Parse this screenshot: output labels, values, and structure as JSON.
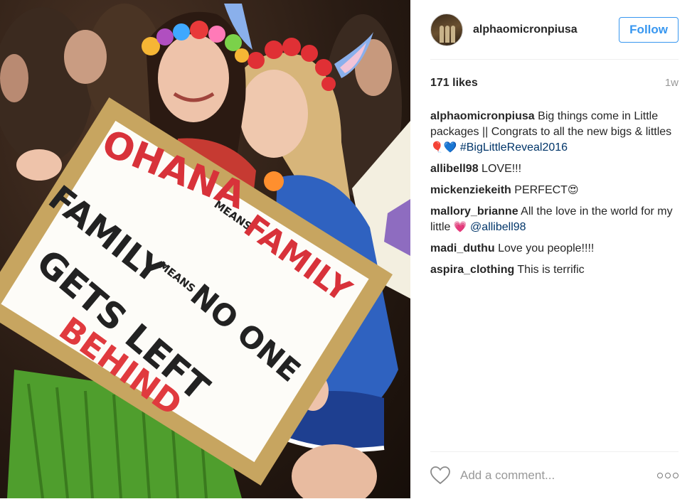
{
  "post": {
    "username": "alphaomicronpiusa",
    "follow_label": "Follow",
    "likes": "171 likes",
    "age": "1w",
    "caption": {
      "user": "alphaomicronpiusa",
      "text": "Big things come in Little packages || Congrats to all the new bigs & littles",
      "emoji": "🎈💙",
      "hashtag": "#BigLittleReveal2016"
    },
    "comments": [
      {
        "user": "allibell98",
        "text": "LOVE!!!",
        "emoji": ""
      },
      {
        "user": "mickenziekeith",
        "text": "PERFECT",
        "emoji": "😍"
      },
      {
        "user": "mallory_brianne",
        "text": "All the love in the world for my little",
        "emoji": "💗",
        "mention": "@allibell98"
      },
      {
        "user": "madi_duthu",
        "text": "Love you people!!!!",
        "emoji": ""
      },
      {
        "user": "aspira_clothing",
        "text": "This is terrific",
        "emoji": ""
      }
    ],
    "add_comment_placeholder": "Add a comment...",
    "colors": {
      "accent": "#3897f0",
      "hashtag": "#003569",
      "muted": "#999999"
    }
  },
  "photo": {
    "sign_lines": [
      "OHANA",
      "MEANS",
      "FAMILY",
      "FAMILY",
      "MEANS",
      "NO ONE",
      "GETS LEFT",
      "BEHIND"
    ]
  }
}
